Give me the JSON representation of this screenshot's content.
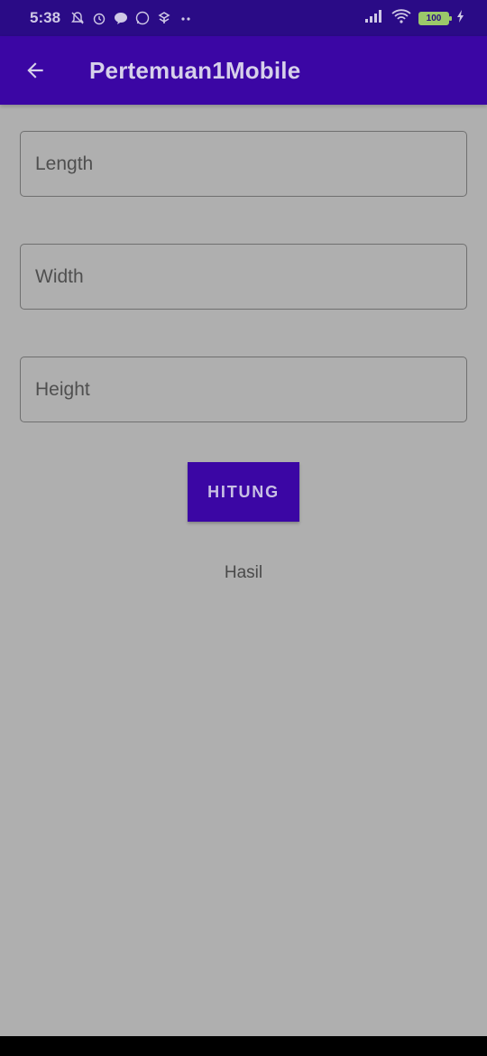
{
  "status_bar": {
    "time": "5:38",
    "battery_level": "100",
    "icons": [
      "muted-bell-icon",
      "alarm-icon",
      "line-icon",
      "whatsapp-icon",
      "app-icon",
      "more-dots-icon",
      "signal-icon",
      "wifi-icon",
      "battery-icon",
      "charging-icon"
    ]
  },
  "app_bar": {
    "title": "Pertemuan1Mobile",
    "back_icon": "arrow-left-icon",
    "color": "#3b06a4"
  },
  "form": {
    "length_placeholder": "Length",
    "width_placeholder": "Width",
    "height_placeholder": "Height",
    "length_value": "",
    "width_value": "",
    "height_value": ""
  },
  "calculate_button": {
    "label": "HITUNG"
  },
  "result": {
    "text": "Hasil"
  },
  "colors": {
    "overlay_bg": "#afafaf",
    "status_bar": "#2a0b86",
    "accent": "#3b06a4"
  }
}
